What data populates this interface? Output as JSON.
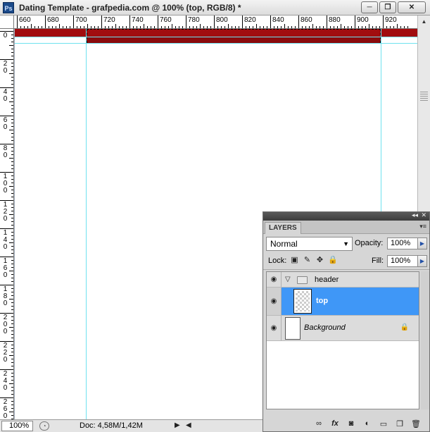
{
  "window": {
    "app_icon": "Ps",
    "title": "Dating Template - grafpedia.com @ 100% (top, RGB/8) *",
    "minimize": "─",
    "restore": "❐",
    "close": "✕"
  },
  "rulers": {
    "horizontal_labels": [
      "660",
      "680",
      "700",
      "720",
      "740",
      "760",
      "780",
      "800",
      "820",
      "840",
      "860",
      "880",
      "900",
      "920"
    ],
    "vertical_labels": [
      "0",
      "20",
      "40",
      "60",
      "80",
      "100",
      "120",
      "140",
      "160",
      "180",
      "200",
      "220",
      "240",
      "260"
    ]
  },
  "statusbar": {
    "zoom": "100%",
    "doc_info": "Doc: 4,58M/1,42M"
  },
  "layers_panel": {
    "tab": "LAYERS",
    "blend_mode": "Normal",
    "opacity_label": "Opacity:",
    "opacity_value": "100%",
    "lock_label": "Lock:",
    "fill_label": "Fill:",
    "fill_value": "100%",
    "layers": [
      {
        "name": "header",
        "type": "group"
      },
      {
        "name": "top",
        "type": "layer",
        "selected": true
      },
      {
        "name": "Background",
        "type": "background",
        "locked": true
      }
    ]
  },
  "colors": {
    "header_bar": "#a10d0f",
    "guide": "#6fe2ef",
    "selection": "#3f97f7"
  }
}
